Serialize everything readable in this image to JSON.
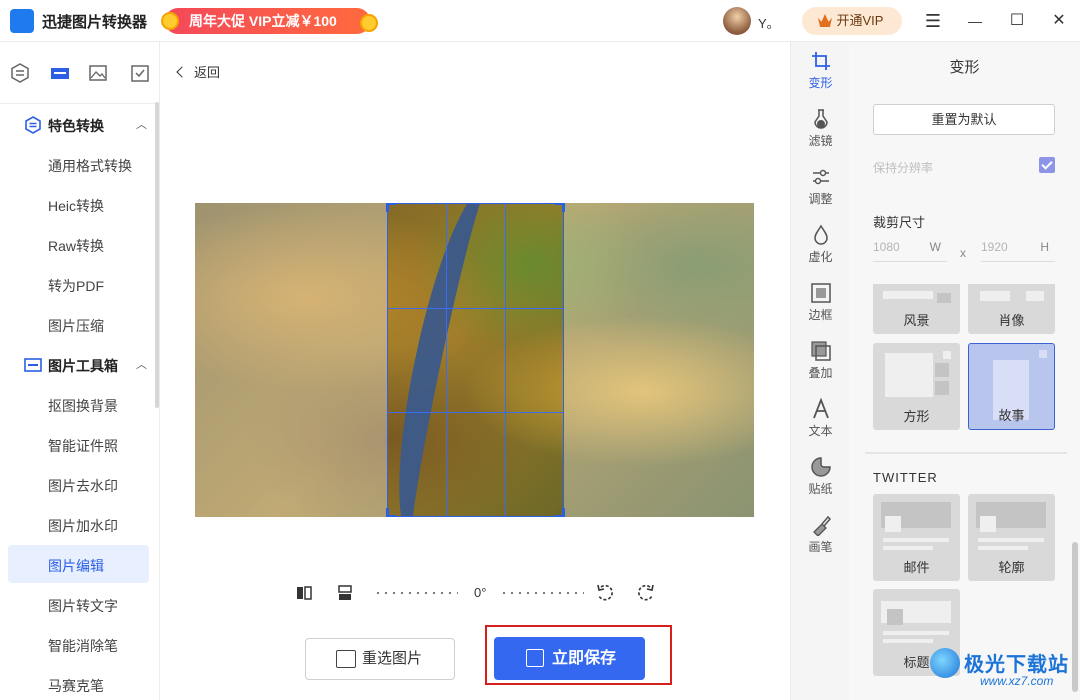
{
  "app": {
    "title": "迅捷图片转换器",
    "promo": "周年大促 VIP立减￥100",
    "user_name": "Y。",
    "vip_button": "开通VIP",
    "window_controls": {
      "menu": "☰",
      "minimize": "—",
      "maximize": "☐",
      "close": "✕"
    }
  },
  "sidebar": {
    "tabs": [
      "convert-icon",
      "toolbox-icon",
      "image-icon",
      "check-icon"
    ],
    "groups": [
      {
        "label": "特色转换",
        "expanded": true,
        "items": [
          "通用格式转换",
          "Heic转换",
          "Raw转换",
          "转为PDF",
          "图片压缩"
        ]
      },
      {
        "label": "图片工具箱",
        "expanded": true,
        "items": [
          "抠图换背景",
          "智能证件照",
          "图片去水印",
          "图片加水印",
          "图片编辑",
          "图片转文字",
          "智能消除笔",
          "马赛克笔"
        ]
      }
    ],
    "active_item": "图片编辑"
  },
  "main": {
    "back_label": "返回",
    "rotation": "0°",
    "reselect_button": "重选图片",
    "save_button": "立即保存"
  },
  "tools": [
    {
      "label": "变形",
      "icon": "crop-icon",
      "active": true
    },
    {
      "label": "滤镜",
      "icon": "filter-icon",
      "active": false
    },
    {
      "label": "调整",
      "icon": "adjust-icon",
      "active": false
    },
    {
      "label": "虚化",
      "icon": "blur-icon",
      "active": false
    },
    {
      "label": "边框",
      "icon": "frame-icon",
      "active": false
    },
    {
      "label": "叠加",
      "icon": "overlay-icon",
      "active": false
    },
    {
      "label": "文本",
      "icon": "text-icon",
      "active": false
    },
    {
      "label": "贴纸",
      "icon": "sticker-icon",
      "active": false
    },
    {
      "label": "画笔",
      "icon": "brush-icon",
      "active": false
    }
  ],
  "panel": {
    "title": "变形",
    "reset_button": "重置为默认",
    "keep_resolution": "保持分辨率",
    "keep_resolution_checked": true,
    "crop_size_label": "裁剪尺寸",
    "width_value": "1080",
    "width_unit": "W",
    "separator": "x",
    "height_value": "1920",
    "height_unit": "H",
    "presets": [
      {
        "label": "风景",
        "selected": false
      },
      {
        "label": "肖像",
        "selected": false
      },
      {
        "label": "方形",
        "selected": false
      },
      {
        "label": "故事",
        "selected": true
      }
    ],
    "twitter_section": "TWITTER",
    "twitter_presets": [
      {
        "label": "邮件"
      },
      {
        "label": "轮廓"
      },
      {
        "label": "标题"
      }
    ]
  },
  "watermark": {
    "name": "极光下载站",
    "url": "www.xz7.com"
  },
  "colors": {
    "accent": "#3568f0",
    "highlight": "#d7201b",
    "selected_preset": "#b8c5ec"
  }
}
